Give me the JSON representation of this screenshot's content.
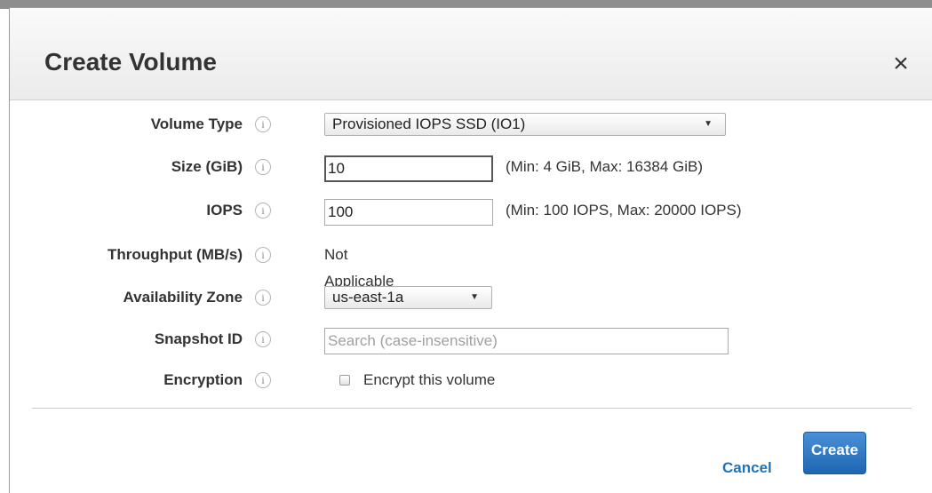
{
  "dialog": {
    "title": "Create Volume",
    "close_glyph": "×"
  },
  "fields": {
    "volume_type": {
      "label": "Volume Type",
      "value": "Provisioned IOPS SSD (IO1)",
      "caret": "▼"
    },
    "size": {
      "label": "Size (GiB)",
      "value": "10",
      "hint": "(Min: 4 GiB, Max: 16384 GiB)"
    },
    "iops": {
      "label": "IOPS",
      "value": "100",
      "hint": "(Min: 100 IOPS, Max: 20000 IOPS)"
    },
    "throughput": {
      "label": "Throughput (MB/s)",
      "value": "Not Applicable"
    },
    "availability_zone": {
      "label": "Availability Zone",
      "value": "us-east-1a",
      "caret": "▼"
    },
    "snapshot_id": {
      "label": "Snapshot ID",
      "placeholder": "Search (case-insensitive)"
    },
    "encryption": {
      "label": "Encryption",
      "checkbox_label": "Encrypt this volume",
      "checked": false
    }
  },
  "info_glyph": "i",
  "footer": {
    "cancel_label": "Cancel",
    "create_label": "Create"
  },
  "colors": {
    "primary_button": "#1e66b3",
    "link": "#1f73b8",
    "header_bg": "#ebebeb"
  },
  "icons": {
    "info": "info-icon",
    "close": "close-icon",
    "dropdown": "chevron-down-icon"
  }
}
